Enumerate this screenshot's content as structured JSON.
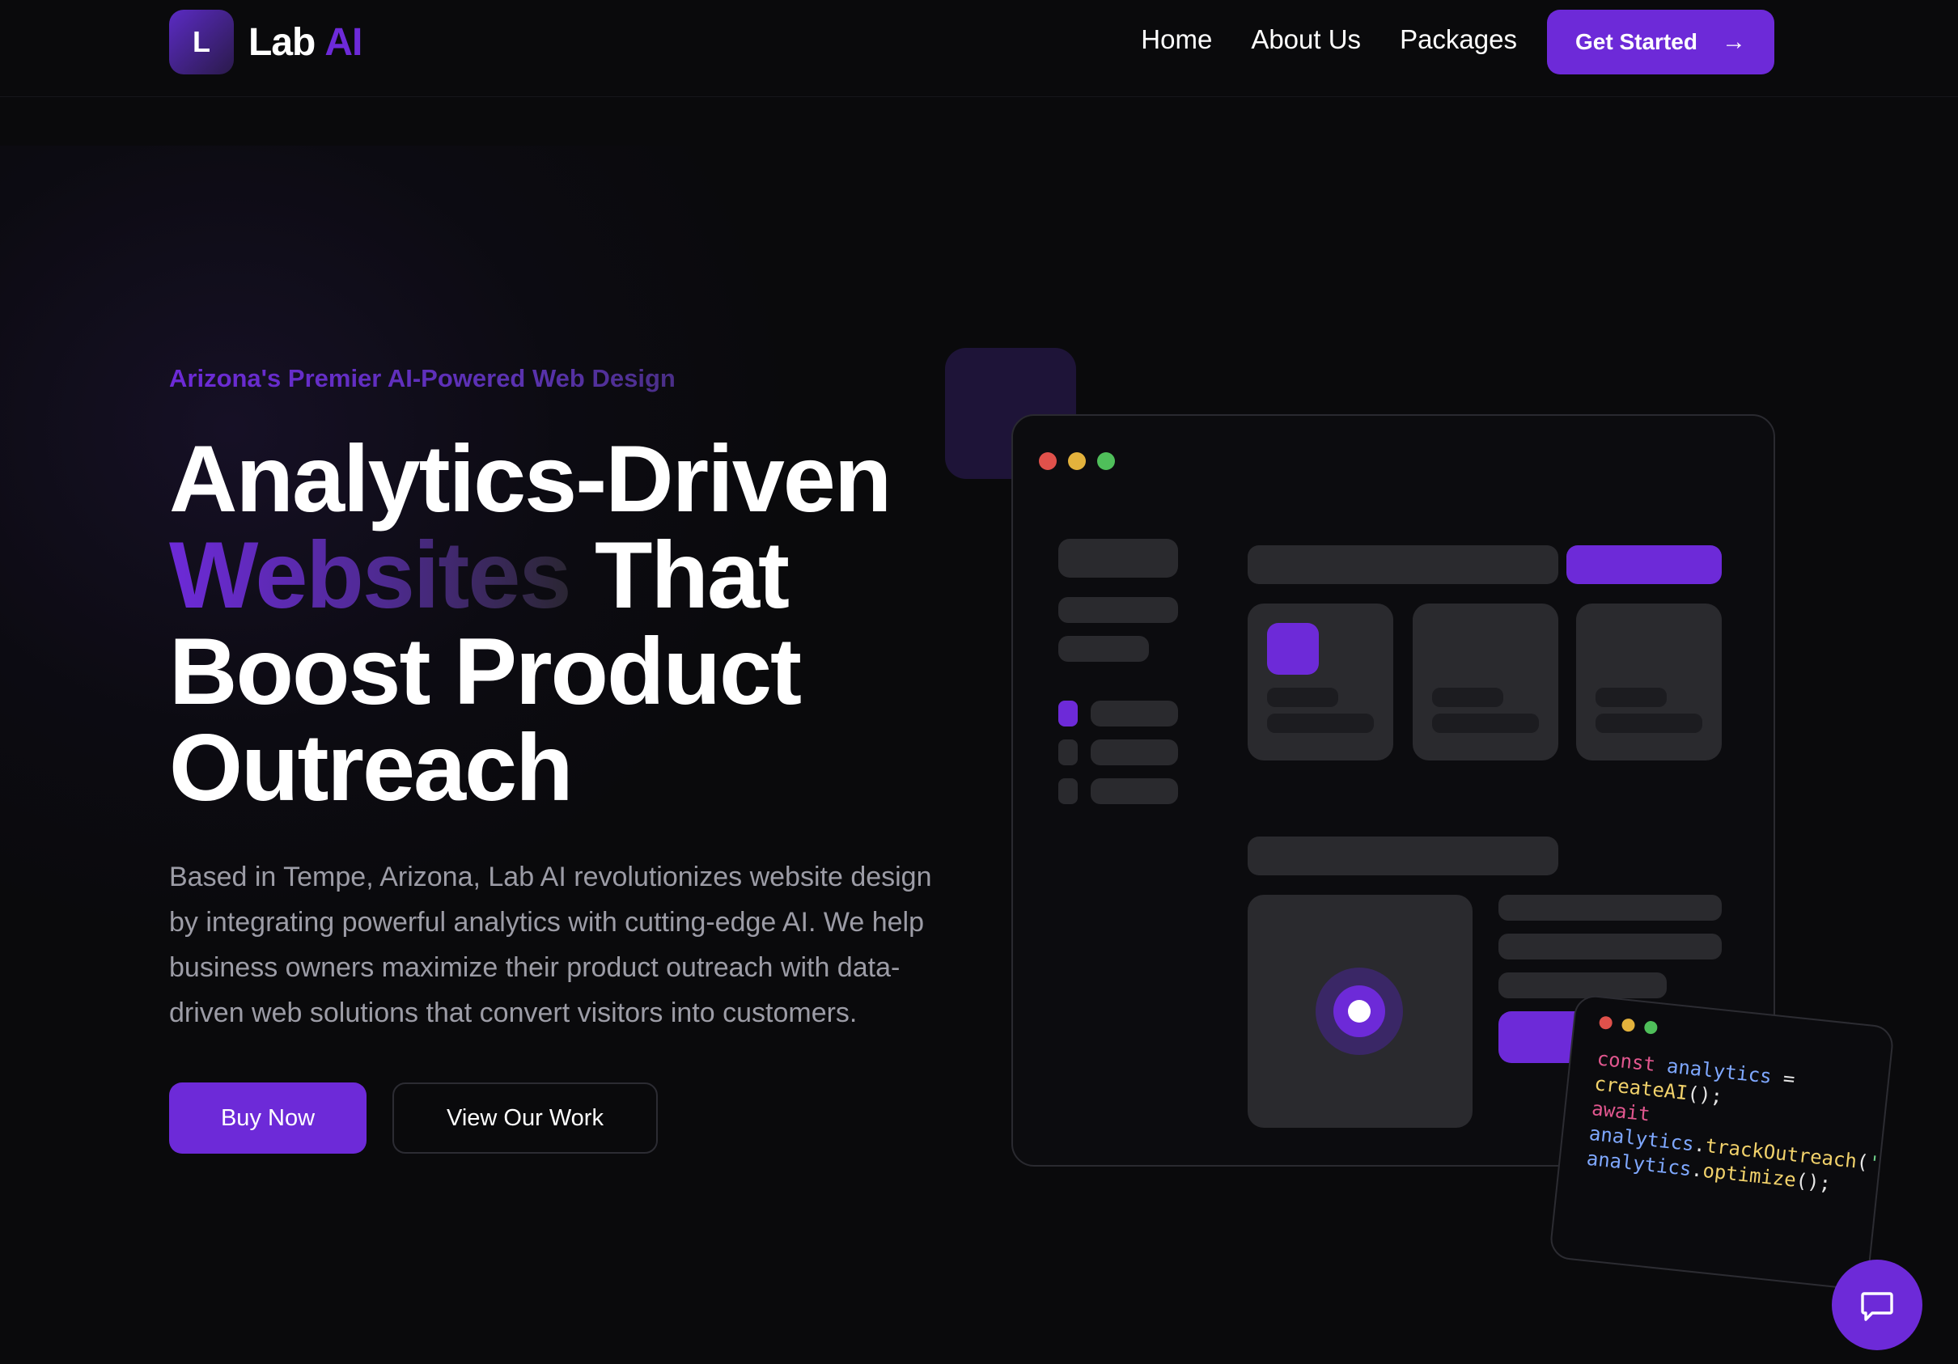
{
  "brand": {
    "badge_letter": "L",
    "name": "Lab",
    "accent": "AI"
  },
  "nav": {
    "items": [
      {
        "label": "Home"
      },
      {
        "label": "About Us"
      },
      {
        "label": "Packages"
      }
    ],
    "cta_label": "Get Started",
    "cta_icon": "arrow-right-icon"
  },
  "hero": {
    "eyebrow": "Arizona's Premier AI-Powered Web Design",
    "headline_line1": "Analytics-Driven",
    "headline_accent": "Websites",
    "headline_line2_rest": " That",
    "headline_line3": "Boost Product",
    "headline_line4": "Outreach",
    "description": "Based in Tempe, Arizona, Lab AI revolutionizes website design by integrating powerful analytics with cutting-edge AI. We help business owners maximize their product outreach with data-driven web solutions that convert visitors into customers.",
    "primary_button": "Buy Now",
    "secondary_button": "View Our Work"
  },
  "code_card": {
    "line1_kw": "const",
    "line1_var": "analytics",
    "line1_op": " =",
    "line2_fn": "createAI",
    "line2_tail": "();",
    "line3_kw": "await",
    "line4_var": "analytics",
    "line4_dot": ".",
    "line4_fn": "trackOutreach",
    "line4_paren": "(",
    "line4_str": "'product'",
    "line5_var": "analytics",
    "line5_dot": ".",
    "line5_fn": "optimize",
    "line5_tail": "();"
  },
  "colors": {
    "accent": "#6d2ad8",
    "background": "#0a0a0c",
    "traffic_red": "#e0514b",
    "traffic_yellow": "#e3b23c",
    "traffic_green": "#4fbf5a"
  },
  "chat": {
    "icon": "chat-bubble-icon"
  }
}
